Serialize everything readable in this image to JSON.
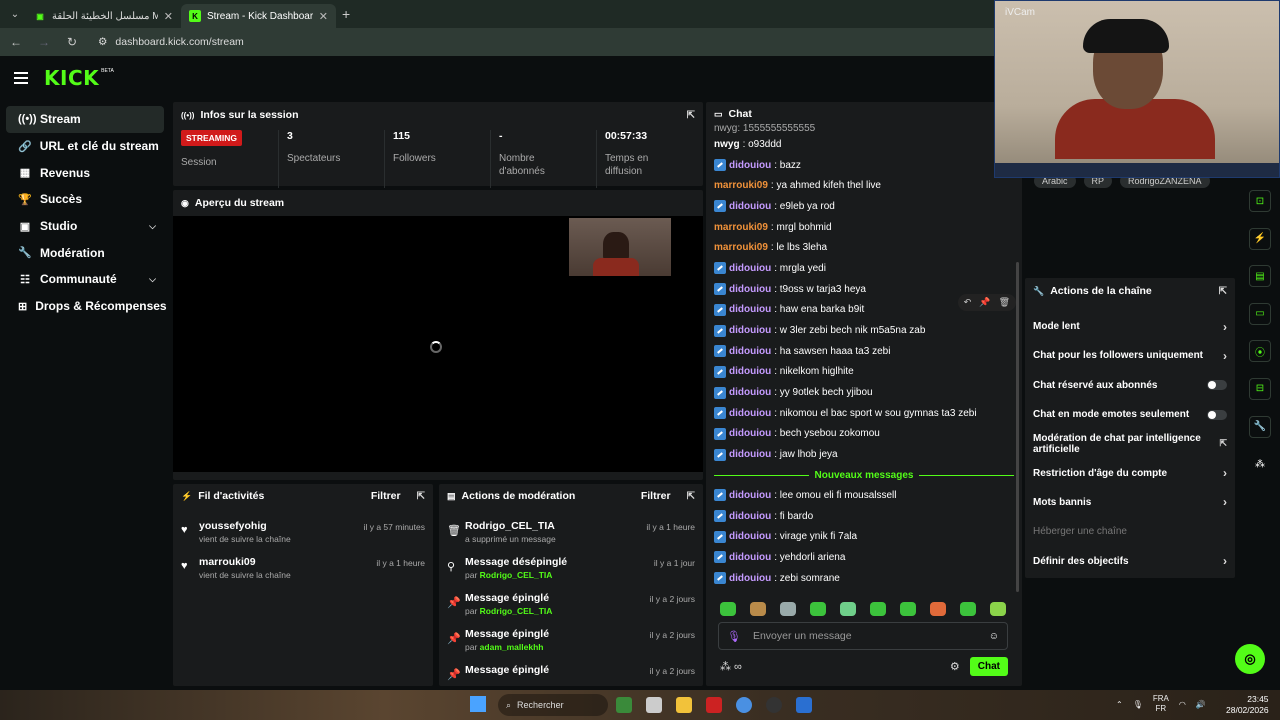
{
  "browser": {
    "tabs": [
      {
        "title": "مسلسل الخطيئة الحلقة MA TN",
        "active": false
      },
      {
        "title": "Stream - Kick Dashboard",
        "active": true
      }
    ],
    "url": "dashboard.kick.com/stream"
  },
  "app": {
    "logo": "KICK",
    "logo_badge": "BETA"
  },
  "sidebar": {
    "items": [
      {
        "label": "Stream",
        "icon": "broadcast-icon",
        "glyph": "((•))"
      },
      {
        "label": "URL et clé du stream",
        "icon": "link-icon",
        "glyph": "🔗"
      },
      {
        "label": "Revenus",
        "icon": "revenue-icon",
        "glyph": "▦"
      },
      {
        "label": "Succès",
        "icon": "trophy-icon",
        "glyph": "🏆"
      },
      {
        "label": "Studio",
        "icon": "studio-icon",
        "glyph": "▣"
      },
      {
        "label": "Modération",
        "icon": "wrench-icon",
        "glyph": "🔧"
      },
      {
        "label": "Communauté",
        "icon": "community-icon",
        "glyph": "☷"
      },
      {
        "label": "Drops & Récompenses",
        "icon": "drops-icon",
        "glyph": "⊞"
      }
    ]
  },
  "session": {
    "title": "Infos sur la session",
    "status_badge": "STREAMING",
    "stats": [
      {
        "value": "",
        "label": "Session"
      },
      {
        "value": "3",
        "label": "Spectateurs"
      },
      {
        "value": "115",
        "label": "Followers"
      },
      {
        "value": "-",
        "label": "Nombre d'abonnés"
      },
      {
        "value": "00:57:33",
        "label": "Temps en diffusion"
      }
    ]
  },
  "preview": {
    "title": "Aperçu du stream"
  },
  "activity": {
    "title": "Fil d'activités",
    "filter": "Filtrer",
    "items": [
      {
        "name": "youssefyohig",
        "sub": "vient de suivre la chaîne",
        "time": "il y a 57 minutes"
      },
      {
        "name": "marrouki09",
        "sub": "vient de suivre la chaîne",
        "time": "il y a 1 heure"
      }
    ]
  },
  "moderation": {
    "title": "Actions de modération",
    "filter": "Filtrer",
    "items": [
      {
        "name": "Rodrigo_CEL_TIA",
        "prefix": "a supprimé un message",
        "actor": "",
        "time": "il y a 1 heure",
        "icon": "trash-icon",
        "glyph": "🗑"
      },
      {
        "name": "Message désépinglé",
        "prefix": "par",
        "actor": "Rodrigo_CEL_TIA",
        "time": "il y a 1 jour",
        "icon": "unpin-icon",
        "glyph": "⚲"
      },
      {
        "name": "Message épinglé",
        "prefix": "par",
        "actor": "Rodrigo_CEL_TIA",
        "time": "il y a 2 jours",
        "icon": "pin-icon",
        "glyph": "📌"
      },
      {
        "name": "Message épinglé",
        "prefix": "par",
        "actor": "adam_mallekhh",
        "time": "il y a 2 jours",
        "icon": "pin-icon",
        "glyph": "📌"
      },
      {
        "name": "Message épinglé",
        "prefix": "",
        "actor": "",
        "time": "il y a 2 jours",
        "icon": "pin-icon",
        "glyph": "📌"
      }
    ]
  },
  "chat": {
    "title": "Chat",
    "messages": [
      {
        "user": "nwyg",
        "text": "o93ddd",
        "badge": false,
        "color": "#ffffff"
      },
      {
        "user": "didouiou",
        "text": "bazz",
        "badge": true,
        "color": "#c59bff"
      },
      {
        "user": "marrouki09",
        "text": "ya ahmed kifeh thel live",
        "badge": false,
        "color": "#f0923a"
      },
      {
        "user": "didouiou",
        "text": "e9leb ya rod",
        "badge": true,
        "color": "#c59bff"
      },
      {
        "user": "marrouki09",
        "text": "mrgl bohmid",
        "badge": false,
        "color": "#f0923a"
      },
      {
        "user": "marrouki09",
        "text": "le lbs 3leha",
        "badge": false,
        "color": "#f0923a"
      },
      {
        "user": "didouiou",
        "text": "mrgla yedi",
        "badge": true,
        "color": "#c59bff"
      },
      {
        "user": "didouiou",
        "text": "t9oss w tarja3 heya",
        "badge": true,
        "color": "#c59bff"
      },
      {
        "user": "didouiou",
        "text": "haw ena barka b9it",
        "badge": true,
        "color": "#c59bff"
      },
      {
        "user": "didouiou",
        "text": "w 3ler zebi bech nik m5a5na zab",
        "badge": true,
        "color": "#c59bff"
      },
      {
        "user": "didouiou",
        "text": "ha sawsen haaa ta3 zebi",
        "badge": true,
        "color": "#c59bff"
      },
      {
        "user": "didouiou",
        "text": "nikelkom higlhite",
        "badge": true,
        "color": "#c59bff"
      },
      {
        "user": "didouiou",
        "text": "yy 9otlek bech yjibou",
        "badge": true,
        "color": "#c59bff"
      },
      {
        "user": "didouiou",
        "text": "nikomou el bac sport w sou gymnas ta3 zebi",
        "badge": true,
        "color": "#c59bff"
      },
      {
        "user": "didouiou",
        "text": "bech ysebou zokomou",
        "badge": true,
        "color": "#c59bff"
      },
      {
        "user": "didouiou",
        "text": "jaw lhob jeya",
        "badge": true,
        "color": "#c59bff"
      }
    ],
    "new_messages_label": "Nouveaux messages",
    "new_messages": [
      {
        "user": "didouiou",
        "text": "lee omou eli fi mousalssell",
        "badge": true,
        "color": "#c59bff"
      },
      {
        "user": "didouiou",
        "text": "fi bardo",
        "badge": true,
        "color": "#c59bff"
      },
      {
        "user": "didouiou",
        "text": "virage ynik fi 7ala",
        "badge": true,
        "color": "#c59bff"
      },
      {
        "user": "didouiou",
        "text": "yehdorli ariena",
        "badge": true,
        "color": "#c59bff"
      },
      {
        "user": "didouiou",
        "text": "zebi somrane",
        "badge": true,
        "color": "#c59bff"
      }
    ],
    "input_placeholder": "Envoyer un message",
    "send_label": "Chat"
  },
  "tags": [
    "Arabic",
    "RP",
    "RodrigoZANZENA"
  ],
  "channel_actions": {
    "title": "Actions de la chaîne",
    "items": [
      {
        "label": "Mode lent",
        "control": "chevron"
      },
      {
        "label": "Chat pour les followers uniquement",
        "control": "chevron"
      },
      {
        "label": "Chat réservé aux abonnés",
        "control": "toggle"
      },
      {
        "label": "Chat en mode emotes seulement",
        "control": "toggle"
      },
      {
        "label": "Modération de chat par intelligence artificielle",
        "control": "external"
      },
      {
        "label": "Restriction d'âge du compte",
        "control": "chevron"
      },
      {
        "label": "Mots bannis",
        "control": "chevron"
      },
      {
        "label": "Héberger une chaîne",
        "control": "none"
      },
      {
        "label": "Définir des objectifs",
        "control": "chevron"
      }
    ]
  },
  "webcam": {
    "label": "iVCam"
  },
  "taskbar": {
    "search_placeholder": "Rechercher",
    "lang_top": "FRA",
    "lang_bottom": "FR",
    "time": "23:45",
    "date": "28/02/2026"
  },
  "colors": {
    "brand_green": "#53fc18",
    "live_red": "#d11a1a",
    "panel": "#191b1c"
  }
}
